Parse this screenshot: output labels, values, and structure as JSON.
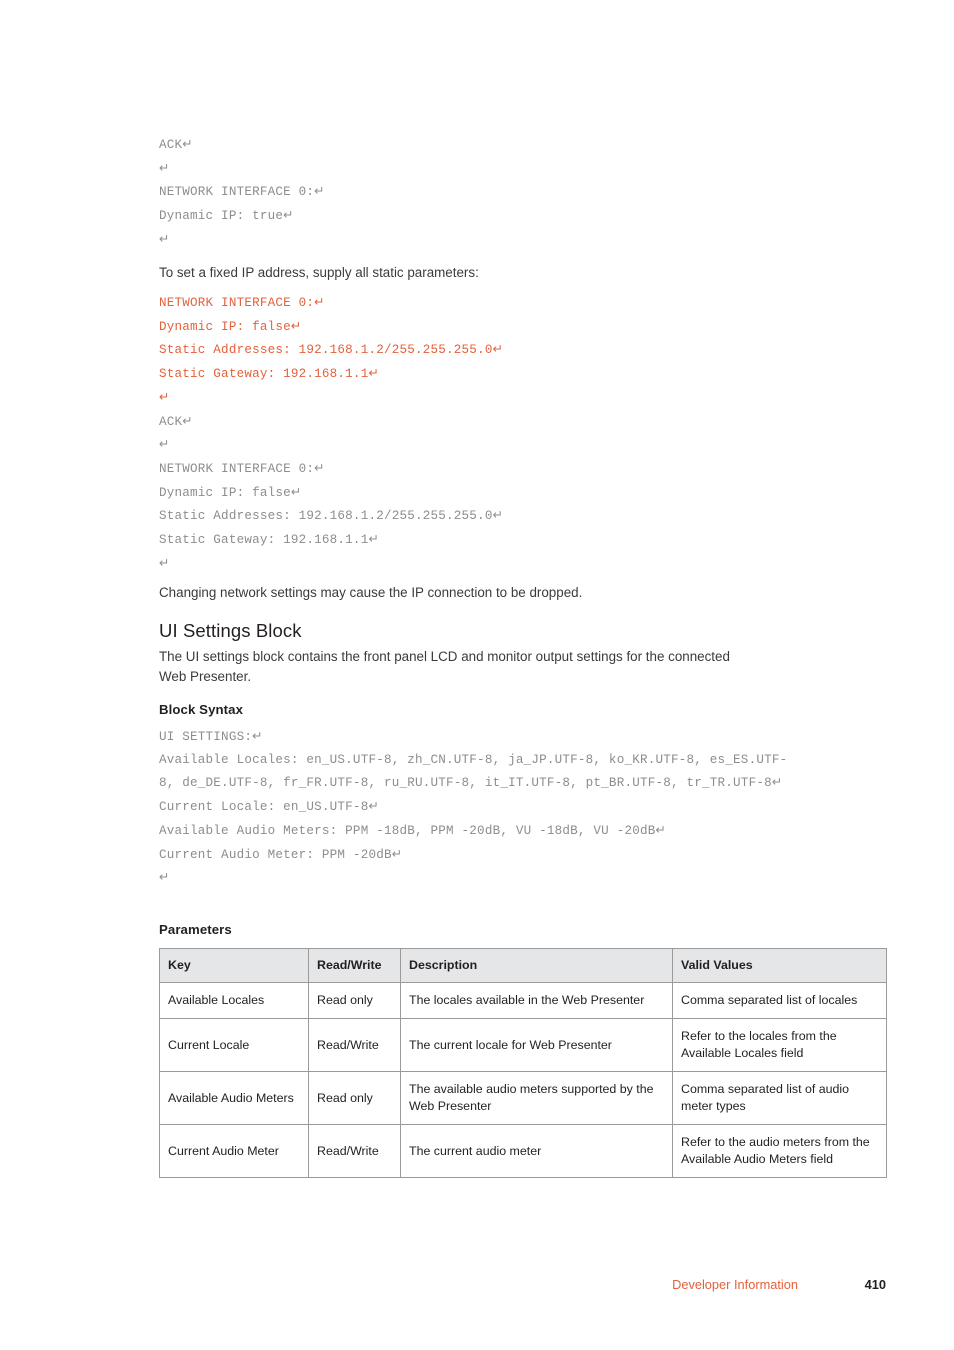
{
  "code_block_1": {
    "lines": [
      {
        "text": "ACK",
        "ret": true,
        "color": "gray"
      },
      {
        "text": "",
        "ret": true,
        "color": "gray"
      },
      {
        "text": "NETWORK INTERFACE 0:",
        "ret": true,
        "color": "gray"
      },
      {
        "text": "Dynamic IP: true",
        "ret": true,
        "color": "gray"
      },
      {
        "text": "",
        "ret": true,
        "color": "gray"
      }
    ]
  },
  "intro_fixed_ip": "To set a fixed IP address, supply all static parameters:",
  "code_block_2": {
    "lines": [
      {
        "text": "NETWORK INTERFACE 0:",
        "ret": true,
        "color": "orange"
      },
      {
        "text": "Dynamic IP: false",
        "ret": true,
        "color": "orange"
      },
      {
        "text": "Static Addresses: 192.168.1.2/255.255.255.0",
        "ret": true,
        "color": "orange"
      },
      {
        "text": "Static Gateway: 192.168.1.1",
        "ret": true,
        "color": "orange"
      },
      {
        "text": "",
        "ret": true,
        "color": "orange"
      },
      {
        "text": "ACK",
        "ret": true,
        "color": "gray"
      },
      {
        "text": "",
        "ret": true,
        "color": "gray"
      },
      {
        "text": "NETWORK INTERFACE 0:",
        "ret": true,
        "color": "gray"
      },
      {
        "text": "Dynamic IP: false",
        "ret": true,
        "color": "gray"
      },
      {
        "text": "Static Addresses: 192.168.1.2/255.255.255.0",
        "ret": true,
        "color": "gray"
      },
      {
        "text": "Static Gateway: 192.168.1.1",
        "ret": true,
        "color": "gray"
      },
      {
        "text": "",
        "ret": true,
        "color": "gray"
      }
    ]
  },
  "note_dropped": "Changing network settings may cause the IP connection to be dropped.",
  "section": {
    "heading": "UI Settings Block",
    "description": "The UI settings block contains the front panel LCD and monitor output settings for the connected Web Presenter.",
    "syntax_label": "Block Syntax",
    "parameters_label": "Parameters"
  },
  "code_block_3": {
    "lines": [
      {
        "text": "UI SETTINGS:",
        "ret": true,
        "color": "gray"
      },
      {
        "text": "Available Locales: en_US.UTF-8, zh_CN.UTF-8, ja_JP.UTF-8, ko_KR.UTF-8, es_ES.UTF-8, de_DE.UTF-8, fr_FR.UTF-8, ru_RU.UTF-8, it_IT.UTF-8, pt_BR.UTF-8, tr_TR.UTF-8",
        "ret": true,
        "color": "gray"
      },
      {
        "text": "Current Locale: en_US.UTF-8",
        "ret": true,
        "color": "gray"
      },
      {
        "text": "Available Audio Meters: PPM -18dB, PPM -20dB, VU -18dB, VU -20dB",
        "ret": true,
        "color": "gray"
      },
      {
        "text": "Current Audio Meter: PPM -20dB",
        "ret": true,
        "color": "gray"
      },
      {
        "text": "",
        "ret": true,
        "color": "gray"
      }
    ]
  },
  "parameters_table": {
    "headers": [
      "Key",
      "Read/Write",
      "Description",
      "Valid Values"
    ],
    "rows": [
      {
        "key": "Available Locales",
        "read_write": "Read only",
        "description": "The locales available in the Web Presenter",
        "valid_values": "Comma separated list of locales"
      },
      {
        "key": "Current Locale",
        "read_write": "Read/Write",
        "description": "The current locale for Web Presenter",
        "valid_values": "Refer to the locales from the Available Locales field"
      },
      {
        "key": "Available Audio Meters",
        "read_write": "Read only",
        "description": "The available audio meters supported by the Web Presenter",
        "valid_values": "Comma separated list of audio meter types"
      },
      {
        "key": "Current Audio Meter",
        "read_write": "Read/Write",
        "description": "The current audio meter",
        "valid_values": "Refer to the audio meters from the Available Audio Meters field"
      }
    ]
  },
  "footer": {
    "label": "Developer Information",
    "page_number": "410"
  },
  "colors": {
    "accent_orange": "#e4613c",
    "code_gray": "#8b8d8f",
    "text_dark": "#231f20",
    "table_header_bg": "#e5e6e7",
    "table_border": "#9a9a9a"
  },
  "return_glyph": "↵"
}
